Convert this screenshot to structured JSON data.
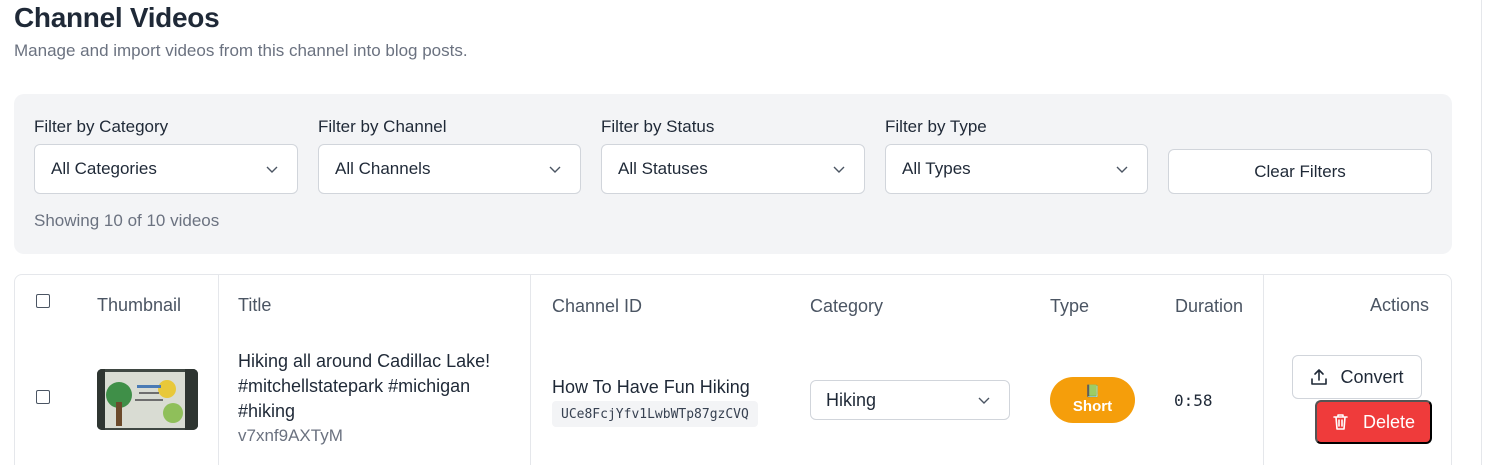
{
  "header": {
    "title": "Channel Videos",
    "subtitle": "Manage and import videos from this channel into blog posts."
  },
  "filters": {
    "category": {
      "label": "Filter by Category",
      "value": "All Categories"
    },
    "channel": {
      "label": "Filter by Channel",
      "value": "All Channels"
    },
    "status": {
      "label": "Filter by Status",
      "value": "All Statuses"
    },
    "type": {
      "label": "Filter by Type",
      "value": "All Types"
    },
    "clear_label": "Clear Filters",
    "count_text": "Showing 10 of 10 videos"
  },
  "table": {
    "columns": [
      "Thumbnail",
      "Title",
      "Channel ID",
      "Category",
      "Type",
      "Duration",
      "Actions"
    ],
    "rows": [
      {
        "title": "Hiking all around Cadillac Lake! #mitchellstatepark #michigan #hiking",
        "video_id": "v7xnf9AXTyM",
        "channel_name": "How To Have Fun Hiking",
        "channel_id": "UCe8FcjYfv1LwbWTp87gzCVQ",
        "category": "Hiking",
        "type_emoji": "📗",
        "type": "Short",
        "duration": "0:58",
        "convert_label": "Convert",
        "delete_label": "Delete"
      }
    ]
  },
  "colors": {
    "panel_bg": "#f3f4f6",
    "short_badge": "#f59e0b",
    "delete": "#ef3b3b",
    "border": "#e5e7eb"
  },
  "icons": {
    "chevron": "chevron-down-icon",
    "upload": "upload-icon",
    "trash": "trash-icon"
  }
}
